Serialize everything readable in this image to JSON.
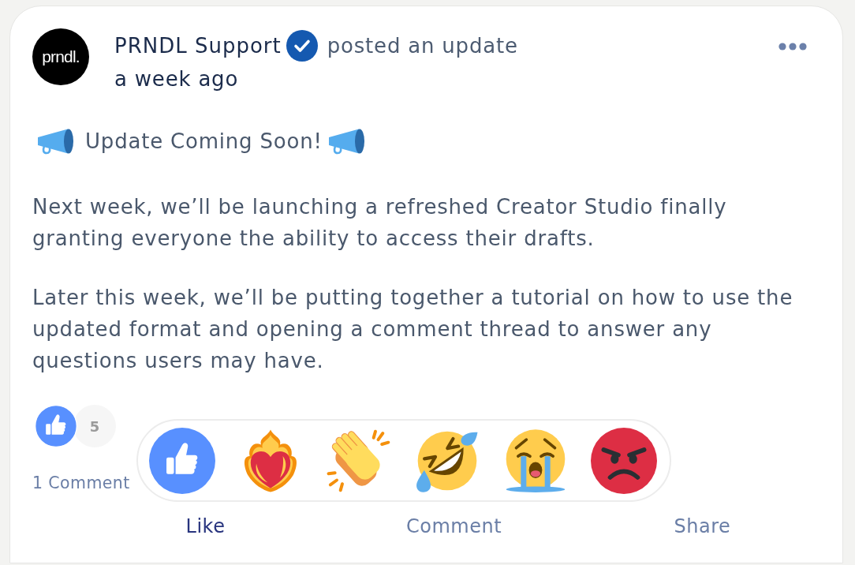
{
  "post": {
    "author": {
      "logo_text": "prndl.",
      "name": "PRNDL Support",
      "verified": true
    },
    "action_text": "posted an update",
    "time": "a week ago",
    "headline": "Update Coming Soon!",
    "paragraphs": [
      "Next week, we’ll be launching a refreshed Creator Studio finally granting everyone the ability to access their drafts.",
      "Later this week, we’ll be putting together a tutorial on how to use the updated format and opening a comment thread to answer any questions users may have."
    ],
    "reaction_count": "5",
    "comments_link": "1 Comment",
    "reaction_picker_open": true,
    "actions": [
      {
        "label": "Like",
        "selected": true
      },
      {
        "label": "Comment",
        "selected": false
      },
      {
        "label": "Share",
        "selected": false
      }
    ]
  }
}
